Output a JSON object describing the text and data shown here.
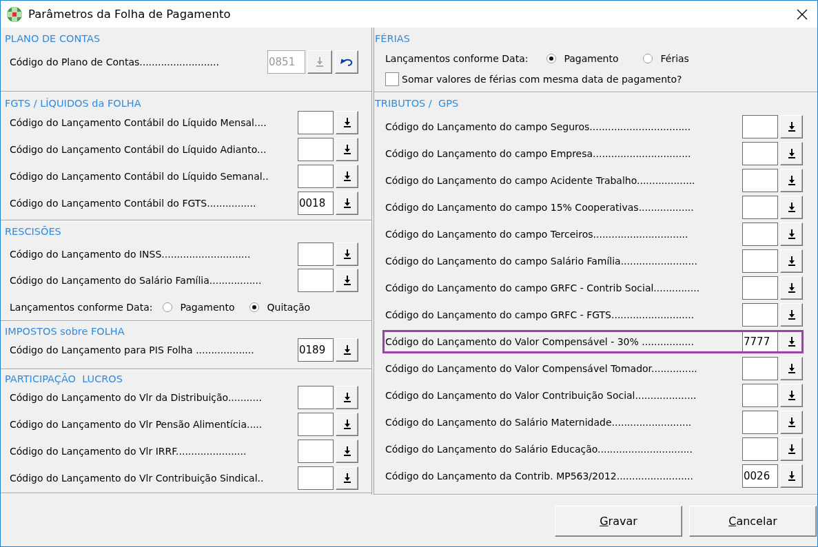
{
  "window": {
    "title": "Parâmetros da Folha de Pagamento"
  },
  "plano_de_contas": {
    "title": "PLANO DE CONTAS",
    "label": "Código do Plano de Contas..........................",
    "value": "0851",
    "disabled": true
  },
  "fgts_liquidos": {
    "title": "FGTS / LÍQUIDOS da FOLHA",
    "fields": [
      {
        "label": "Código do Lançamento Contábil do Líquido Mensal...."
      },
      {
        "label": "Código do Lançamento Contábil do Líquido Adianto..."
      },
      {
        "label": "Código do Lançamento Contábil do Líquido Semanal.."
      },
      {
        "label": "Código do Lançamento Contábil do FGTS................",
        "value": "0018"
      }
    ]
  },
  "rescisoes": {
    "title": "RESCISÕES",
    "fields": [
      {
        "label": "Código do Lançamento do INSS............................."
      },
      {
        "label": "Código do Lançamento do Salário Família................."
      }
    ],
    "date_option": {
      "label": "Lançamentos conforme Data:",
      "options": [
        {
          "label": "Pagamento",
          "selected": false
        },
        {
          "label": "Quitação",
          "selected": true
        }
      ]
    }
  },
  "impostos": {
    "title": "IMPOSTOS sobre FOLHA",
    "fields": [
      {
        "label": "Código do Lançamento para PIS Folha ...................",
        "value": "0189"
      }
    ]
  },
  "participacao_lucros": {
    "title": "PARTICIPAÇÃO  LUCROS",
    "fields": [
      {
        "label": "Código do Lançamento do Vlr da Distribuição..........."
      },
      {
        "label": "Código do Lançamento do Vlr Pensão Alimentícia....."
      },
      {
        "label": "Código do Lançamento do Vlr IRRF......................."
      },
      {
        "label": "Código do Lançamento do Vlr Contribuição Sindical.."
      }
    ]
  },
  "ferias": {
    "title": "FÉRIAS",
    "date_option": {
      "label": "Lançamentos conforme Data:",
      "options": [
        {
          "label": "Pagamento",
          "selected": true
        },
        {
          "label": "Férias",
          "selected": false
        }
      ]
    },
    "checkbox": {
      "label": "Somar valores de férias com mesma data de pagamento?",
      "checked": false
    }
  },
  "tributos_gps": {
    "title": "TRIBUTOS /  GPS",
    "fields": [
      {
        "label": "Código do Lançamento do campo Seguros.................................",
        "highlighted": false
      },
      {
        "label": "Código do Lançamento do campo Empresa................................",
        "highlighted": false
      },
      {
        "label": "Código do Lançamento do campo Acidente Trabalho...................",
        "highlighted": false
      },
      {
        "label": "Código do Lançamento do campo 15% Cooperativas..................",
        "highlighted": false
      },
      {
        "label": "Código do Lançamento do campo Terceiros...............................",
        "highlighted": false
      },
      {
        "label": "Código do Lançamento do campo Salário Família.........................",
        "highlighted": false
      },
      {
        "label": "Código do Lançamento do campo GRFC - Contrib Social...............",
        "highlighted": false
      },
      {
        "label": "Código do Lançamento do campo GRFC - FGTS...........................",
        "highlighted": false
      },
      {
        "label": "Código do Lançamento do Valor Compensável - 30% .................",
        "value": "7777",
        "highlighted": true
      },
      {
        "label": "Código do Lançamento do Valor Compensável Tomador...............",
        "highlighted": false
      },
      {
        "label": "Código do Lançamento do Valor Contribuição Social....................",
        "highlighted": false
      },
      {
        "label": "Código do Lançamento do Salário Maternidade..........................",
        "highlighted": false
      },
      {
        "label": "Código do Lançamento do Salário Educação...............................",
        "highlighted": false
      },
      {
        "label": "Código do Lançamento da Contrib. MP563/2012.........................",
        "value": "0026",
        "highlighted": false
      }
    ]
  },
  "buttons": [
    {
      "label": "Gravar",
      "accelerator": true
    },
    {
      "label": "Cancelar",
      "accelerator": true
    }
  ]
}
